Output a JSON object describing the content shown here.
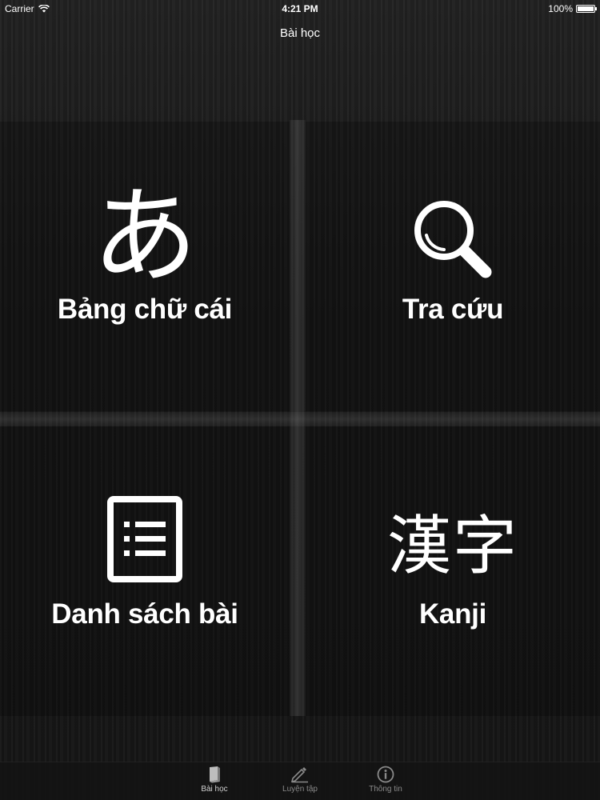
{
  "status_bar": {
    "carrier": "Carrier",
    "time": "4:21 PM",
    "battery": "100%"
  },
  "nav": {
    "title": "Bài học"
  },
  "tiles": [
    {
      "label": "Bảng chữ cái",
      "glyph": "あ",
      "icon": "hiragana-a-icon"
    },
    {
      "label": "Tra cứu",
      "icon": "search-icon"
    },
    {
      "label": "Danh sách bài",
      "icon": "list-icon"
    },
    {
      "label": "Kanji",
      "glyph": "漢字",
      "icon": "kanji-icon"
    }
  ],
  "tab_bar": {
    "items": [
      {
        "label": "Bài học",
        "icon": "book-icon",
        "active": true
      },
      {
        "label": "Luyện tập",
        "icon": "pencil-icon",
        "active": false
      },
      {
        "label": "Thông tin",
        "icon": "info-icon",
        "active": false
      }
    ]
  },
  "colors": {
    "text": "#ffffff",
    "background": "#1a1a1a",
    "tab_inactive": "#8a8a8a"
  }
}
